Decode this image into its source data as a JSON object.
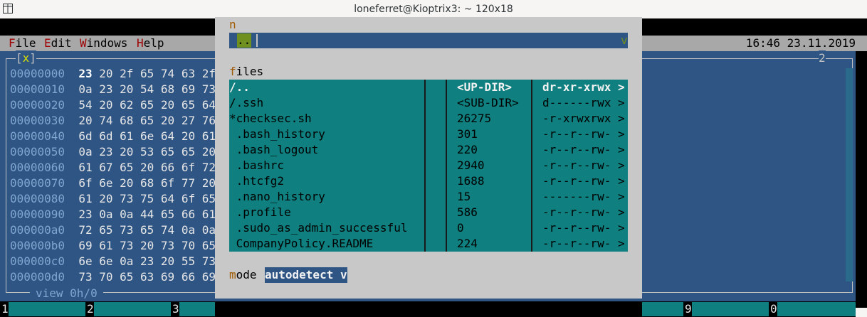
{
  "window": {
    "title": "loneferret@Kioptrix3: ~ 120x18"
  },
  "menu": [
    {
      "hot": "F",
      "rest": "ile"
    },
    {
      "hot": "E",
      "rest": "dit"
    },
    {
      "hot": "W",
      "rest": "indows"
    },
    {
      "hot": "H",
      "rest": "elp"
    }
  ],
  "clock": "16:46 23.11.2019",
  "left_panel": {
    "close_marker": "[x]",
    "panel_number": "2",
    "status": "view 0h/0",
    "hex_lines": [
      {
        "addr": "00000000",
        "first": "23",
        "rest": " 20 2f 65 74 63 2f"
      },
      {
        "addr": "00000010",
        "first": "0a",
        "rest": " 23 20 54 68 69 73"
      },
      {
        "addr": "00000020",
        "first": "54",
        "rest": " 20 62 65 20 65 64"
      },
      {
        "addr": "00000030",
        "first": "20",
        "rest": " 74 68 65 20 27 76"
      },
      {
        "addr": "00000040",
        "first": "6d",
        "rest": " 6d 61 6e 64 20 61"
      },
      {
        "addr": "00000050",
        "first": "0a",
        "rest": " 23 20 53 65 65 20"
      },
      {
        "addr": "00000060",
        "first": "61",
        "rest": " 67 65 20 66 6f 72"
      },
      {
        "addr": "00000070",
        "first": "6f",
        "rest": " 6e 20 68 6f 77 20"
      },
      {
        "addr": "00000080",
        "first": "61",
        "rest": " 20 73 75 64 6f 65"
      },
      {
        "addr": "00000090",
        "first": "23",
        "rest": " 0a 0a 44 65 66 61"
      },
      {
        "addr": "000000a0",
        "first": "72",
        "rest": " 65 73 65 74 0a 0a"
      },
      {
        "addr": "000000b0",
        "first": "69",
        "rest": " 61 73 20 73 70 65"
      },
      {
        "addr": "000000c0",
        "first": "6e",
        "rest": " 6e 0a 23 20 55 73"
      },
      {
        "addr": "000000d0",
        "first": "73",
        "rest": " 70 65 63 69 66 69"
      }
    ]
  },
  "dialog": {
    "path_label_hot": "n",
    "updir_button": "..",
    "path_dropdown": "v",
    "files_label_hot": "f",
    "files_label_rest": "iles",
    "mode_label_hot": "m",
    "mode_label_rest": "ode",
    "mode_value": "autodetect v",
    "files": [
      {
        "name": "/..",
        "size": "<UP-DIR>",
        "perm": "dr-xr-xrwx >"
      },
      {
        "name": "/.ssh",
        "size": "<SUB-DIR>",
        "perm": "d------rwx >"
      },
      {
        "name": "*checksec.sh",
        "size": "26275",
        "perm": "-r-xrwxrwx >"
      },
      {
        "name": " .bash_history",
        "size": "301",
        "perm": "-r--r--rw- >"
      },
      {
        "name": " .bash_logout",
        "size": "220",
        "perm": "-r--r--rw- >"
      },
      {
        "name": " .bashrc",
        "size": "2940",
        "perm": "-r--r--rw- >"
      },
      {
        "name": " .htcfg2",
        "size": "1688",
        "perm": "-r--r--rw- >"
      },
      {
        "name": " .nano_history",
        "size": "15",
        "perm": "-------rw- >"
      },
      {
        "name": " .profile",
        "size": "586",
        "perm": "-r--r--rw- >"
      },
      {
        "name": " .sudo_as_admin_successful",
        "size": "0",
        "perm": "-r--r--rw- >"
      },
      {
        "name": " CompanyPolicy.README",
        "size": "224",
        "perm": "-r--r--rw- >"
      }
    ]
  },
  "fkeys": [
    "1",
    "2",
    "3",
    "9",
    "0"
  ],
  "colors": {
    "panel_blue": "#2f5584",
    "dialog_gray": "#c8c8c8",
    "list_teal": "#0f7f7f",
    "menu_gray": "#a8a8a8",
    "hotkey_red": "#a00000",
    "updir_green": "#6f8f1f"
  },
  "icons": {
    "title_icon": "terminal-icon"
  }
}
